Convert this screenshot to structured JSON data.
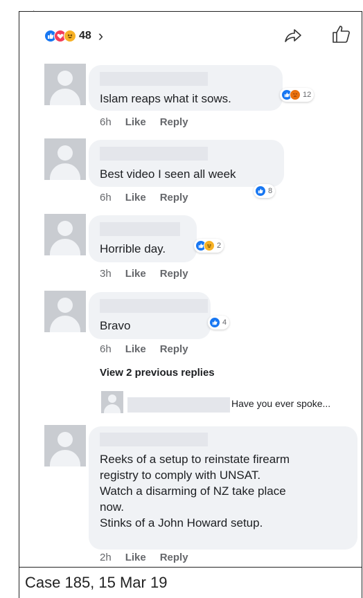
{
  "header": {
    "reaction_total": "48",
    "chevron": "›"
  },
  "comments": [
    {
      "text": "Islam reaps what it sows.",
      "time": "6h",
      "like": "Like",
      "reply": "Reply",
      "reaction_count": "12"
    },
    {
      "text": "Best video I seen all week",
      "time": "6h",
      "like": "Like",
      "reply": "Reply",
      "reaction_count": "8"
    },
    {
      "text": "Horrible day.",
      "time": "3h",
      "like": "Like",
      "reply": "Reply",
      "reaction_count": "2"
    },
    {
      "text": "Bravo",
      "time": "6h",
      "like": "Like",
      "reply": "Reply",
      "reaction_count": "4"
    },
    {
      "lines": [
        "Reeks of a setup to reinstate firearm",
        "registry to comply with UNSAT.",
        "Watch a disarming of NZ take place",
        "now.",
        "Stinks of a John Howard setup."
      ],
      "time": "2h",
      "like": "Like",
      "reply": "Reply"
    }
  ],
  "replies": {
    "view_previous": "View 2 previous replies",
    "preview_text": "Have you ever spoke..."
  },
  "caption": "Case 185, 15 Mar 19",
  "icons": {
    "like": "thumbs-up-icon",
    "love": "heart-icon",
    "haha": "laughing-face-icon",
    "angry": "angry-face-icon",
    "share": "share-arrow-icon",
    "page_like": "thumbs-up-outline-icon"
  },
  "colors": {
    "like": "#1877f2",
    "love": "#f33e58",
    "haha": "#f7b125",
    "angry": "#e9710f",
    "bubble": "#f0f2f5",
    "meta": "#65676b"
  }
}
